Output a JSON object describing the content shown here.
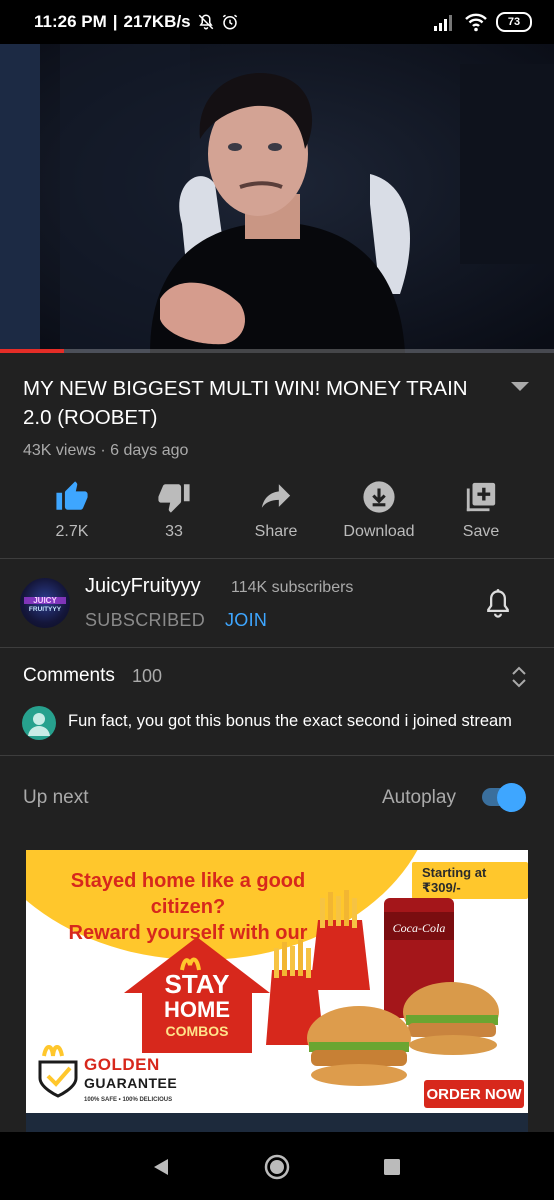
{
  "status_bar": {
    "time": "11:26 PM",
    "separator": "|",
    "network_speed": "217KB/s",
    "battery_level": "73",
    "icons": [
      "mute-bell-icon",
      "alarm-icon",
      "signal-icon",
      "wifi-icon",
      "battery-icon"
    ]
  },
  "video": {
    "progress_fraction": 0.115,
    "title": "MY NEW BIGGEST MULTI WIN! MONEY TRAIN 2.0 (ROOBET)",
    "views": "43K views",
    "meta_separator": "·",
    "age": "6 days ago"
  },
  "actions": [
    {
      "label": "2.7K",
      "icon": "thumbs-up-icon"
    },
    {
      "label": "33",
      "icon": "thumbs-down-icon"
    },
    {
      "label": "Share",
      "icon": "share-icon"
    },
    {
      "label": "Download",
      "icon": "download-icon"
    },
    {
      "label": "Save",
      "icon": "save-to-playlist-icon"
    }
  ],
  "channel": {
    "name": "JuicyFruityyy",
    "subscribers": "114K subscribers",
    "subscribed_label": "SUBSCRIBED",
    "join_label": "JOIN",
    "avatar_text_1": "JUICY",
    "avatar_text_2": "FRUITYYY"
  },
  "comments": {
    "title": "Comments",
    "count": "100",
    "top_comment": "Fun fact, you got this bonus the exact second i joined stream"
  },
  "up_next": {
    "label": "Up next",
    "autoplay_label": "Autoplay",
    "autoplay_on": true
  },
  "ad": {
    "headline_1": "Stayed home like a good citizen?",
    "headline_2": "Reward yourself with our",
    "price_tag": "Starting at ₹309/-",
    "house_stay": "STAY",
    "house_home": "HOME",
    "house_combos": "COMBOS",
    "guarantee_1": "GOLDEN",
    "guarantee_2": "GUARANTEE",
    "guarantee_3": "100% SAFE • 100% DELICIOUS",
    "cta": "ORDER NOW",
    "colors": {
      "yellow": "#ffc72c",
      "red": "#d7281c"
    }
  },
  "nav_bar": {
    "buttons": [
      "back-icon",
      "home-icon",
      "recents-icon"
    ]
  },
  "colors": {
    "background": "#212121",
    "accent_blue": "#3ea6ff",
    "progress_red": "#e52d27"
  }
}
